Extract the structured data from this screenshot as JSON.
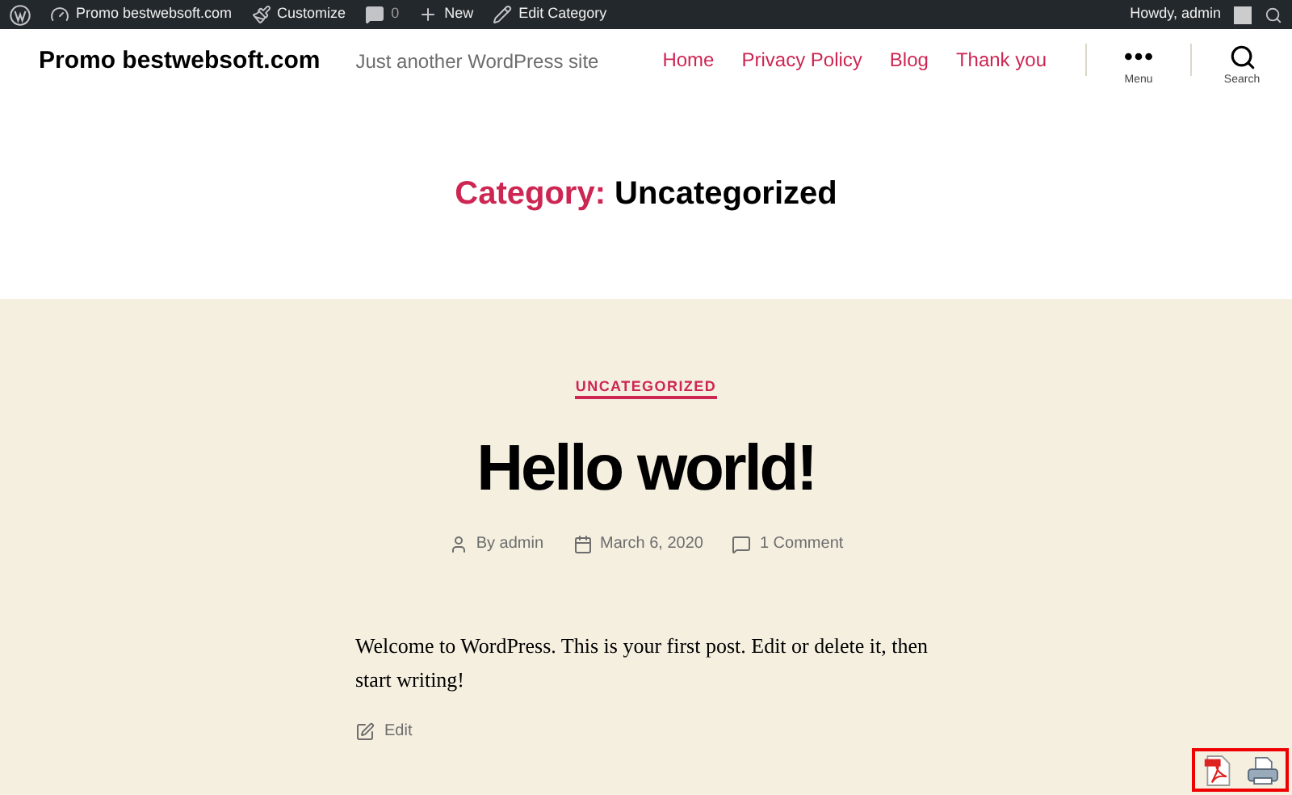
{
  "admin_bar": {
    "items": [
      {
        "kind": "logo"
      },
      {
        "kind": "site",
        "label": "Promo bestwebsoft.com"
      },
      {
        "kind": "customize",
        "label": "Customize"
      },
      {
        "kind": "comments",
        "label": "0"
      },
      {
        "kind": "new",
        "label": "New"
      },
      {
        "kind": "edit",
        "label": "Edit Category"
      }
    ],
    "greeting": "Howdy, admin"
  },
  "header": {
    "site_title": "Promo bestwebsoft.com",
    "tagline": "Just another WordPress site",
    "nav": [
      "Home",
      "Privacy Policy",
      "Blog",
      "Thank you"
    ],
    "menu_label": "Menu",
    "search_label": "Search"
  },
  "archive": {
    "prefix": "Category:",
    "name": "Uncategorized"
  },
  "post": {
    "category": "UNCATEGORIZED",
    "title": "Hello world!",
    "author": "By admin",
    "date": "March 6, 2020",
    "comments": "1 Comment",
    "body": "Welcome to WordPress. This is your first post. Edit or delete it, then start writing!",
    "edit": "Edit"
  }
}
